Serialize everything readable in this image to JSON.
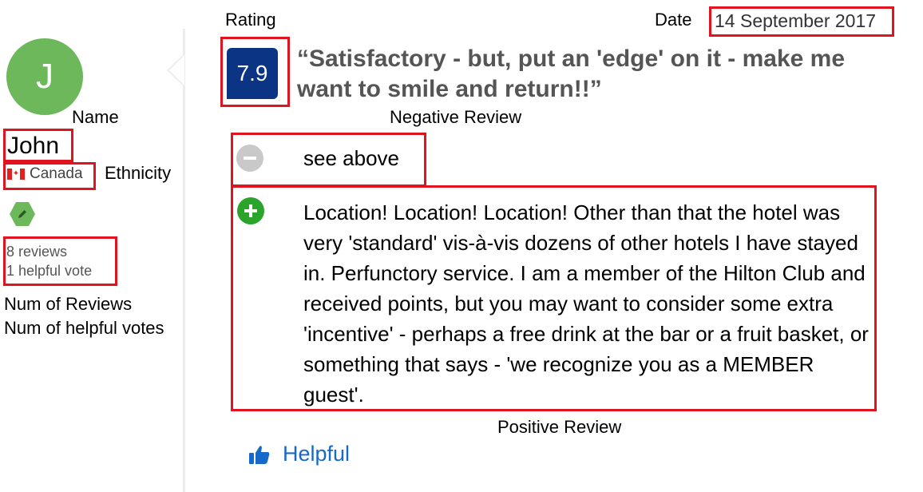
{
  "reviewer": {
    "avatar_initial": "J",
    "name": "John",
    "country": "Canada",
    "reviews_count": "8 reviews",
    "helpful_votes": "1 helpful vote"
  },
  "review": {
    "score": "7.9",
    "date": "14 September 2017",
    "title": "“Satisfactory - but, put an 'edge' on it - make me want to smile and return!!”",
    "negative": "see above",
    "positive": "Location! Location! Location! Other than that the hotel was very 'standard' vis-à-vis dozens of other hotels I have stayed in.  Perfunctory service. I am a member of the Hilton Club and received points, but you may want to consider some extra 'incentive' - perhaps a free drink at the bar or a fruit basket, or something that says - 'we recognize you as a MEMBER guest'.",
    "helpful_label": "Helpful"
  },
  "annotations": {
    "rating": "Rating",
    "date": "Date",
    "name": "Name",
    "ethnicity": "Ethnicity",
    "num_reviews": "Num of Reviews",
    "num_helpful": "Num of helpful votes",
    "negative_review": "Negative Review",
    "positive_review": "Positive Review"
  },
  "colors": {
    "annotation_box": "#e0141e",
    "avatar_bg": "#6cb85a",
    "score_bg": "#0b3485",
    "helpful_link": "#1769c9",
    "positive_icon": "#2aa42a",
    "negative_icon": "#c9c9c9"
  },
  "icons": {
    "badge": "pencil-icon",
    "negative": "minus-icon",
    "positive": "plus-icon",
    "helpful": "thumbs-up-icon",
    "flag": "canada-flag-icon"
  }
}
